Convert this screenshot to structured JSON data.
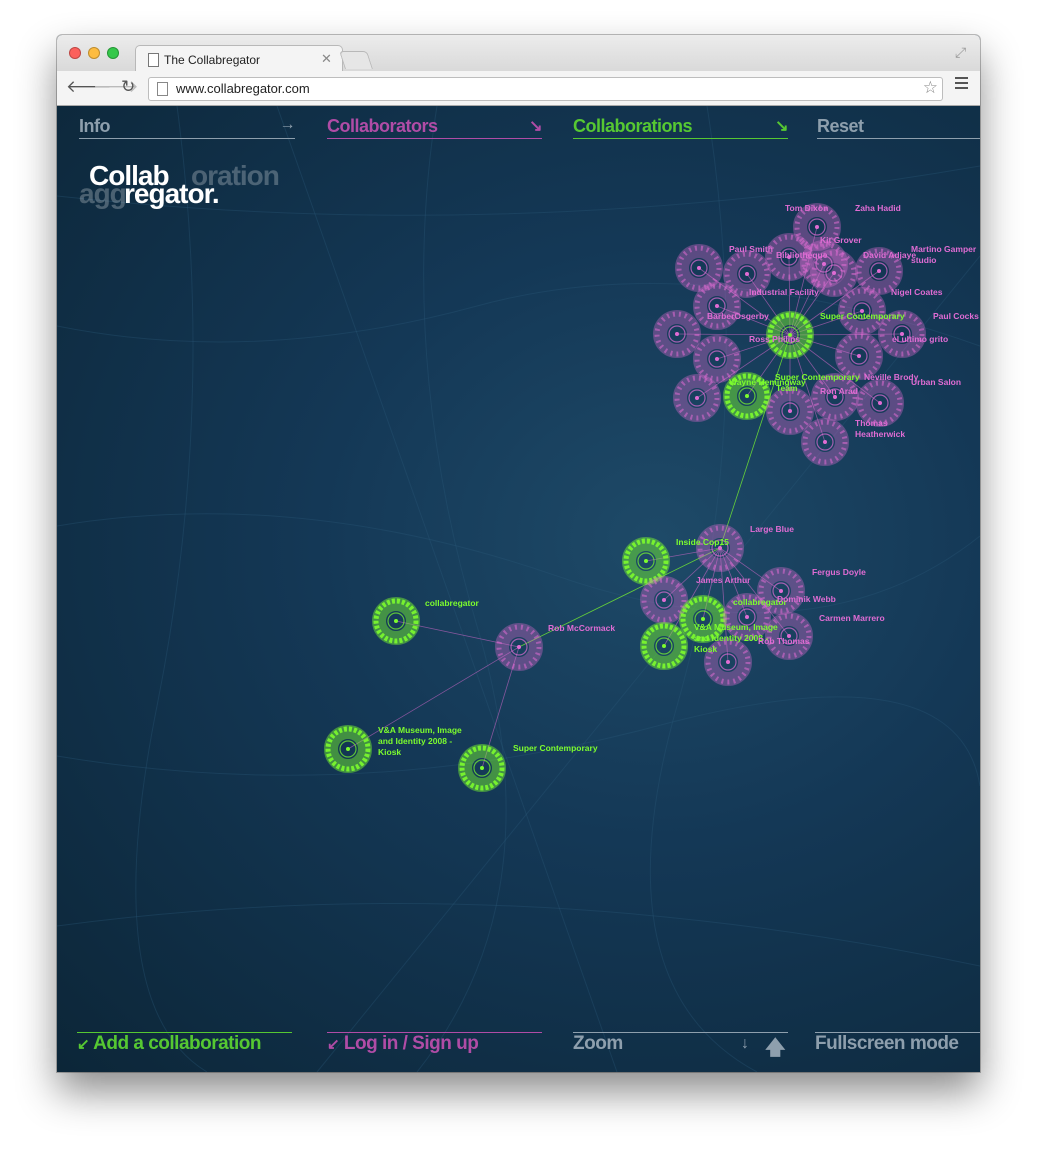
{
  "browser": {
    "tab_title": "The Collabregator",
    "url": "www.collabregator.com",
    "back_icon": "back-arrow-icon",
    "forward_icon": "forward-arrow-icon",
    "reload_icon": "reload-icon",
    "bookmark_icon": "star-icon",
    "menu_icon": "hamburger-menu-icon"
  },
  "colors": {
    "collaborator": "#e06cd4",
    "collaboration": "#7cfc2e",
    "nav_gray": "#8e9fad",
    "background": "#123451"
  },
  "logo": {
    "ghost_top": "oration",
    "ghost_bottom": "agg",
    "main_top": "Collab",
    "main_bottom": "regator."
  },
  "nav": {
    "info": "Info",
    "collaborators": "Collaborators",
    "collaborations": "Collaborations",
    "reset": "Reset",
    "info_arrow": "→",
    "collaborators_arrow": "↘",
    "collaborations_arrow": "↘"
  },
  "footer": {
    "add": "Add a collaboration",
    "login": "Log in / Sign up",
    "zoom": "Zoom",
    "zoom_out": "↓",
    "zoom_in": "🡅",
    "fullscreen": "Fullscreen mode",
    "add_arrow": "↙",
    "login_arrow": "↙"
  },
  "graph_labels": {
    "tom_dixon": "Tom Dixon",
    "zaha_hadid": "Zaha Hadid",
    "kit_grover": "Kit Grover",
    "paul_smith": "Paul Smith",
    "bibliotheque": "Bibliotheque",
    "david_adjaye": "David Adjaye",
    "martino_gamper_1": "Martino Gamper",
    "martino_gamper_2": "studio",
    "industrial_facility": "Industrial Facility",
    "nigel_coates": "Nigel Coates",
    "barberosgerby": "BarberOsgerby",
    "super_contemporary_top": "Super Contemporary",
    "paul_cocksedge": "Paul Cocks",
    "ross_philips": "Ross Philips",
    "el_ultimo_grito": "el ultimo grito",
    "sc_team_1": "Super Contemporary",
    "sc_team_2": "Team",
    "neville_brody": "Neville Brody",
    "wayne_hemingway": "Wayne Hemingway",
    "urban_salon": "Urban Salon",
    "ron_arad": "Ron Arad",
    "thomas_heatherwick_1": "Thomas",
    "thomas_heatherwick_2": "Heatherwick",
    "inside_cop15": "Inside Cop15",
    "large_blue": "Large Blue",
    "fergus_doyle": "Fergus Doyle",
    "james_arthur": "James Arthur",
    "collabregator_mid": "collabregator",
    "dominik_webb": "Dominik Webb",
    "carmen_marrero": "Carmen Marrero",
    "va_mid_1": "V&A Museum, Image",
    "va_mid_2": "and Identity 2008 -",
    "va_mid_3": "Kiosk",
    "rob_thomas": "Rob Thomas",
    "collabregator_left": "collabregator",
    "rob_mccormack": "Rob McCormack",
    "va_left_1": "V&A Museum, Image",
    "va_left_2": "and Identity 2008 -",
    "va_left_3": "Kiosk",
    "super_contemporary_bottom": "Super Contemporary"
  }
}
